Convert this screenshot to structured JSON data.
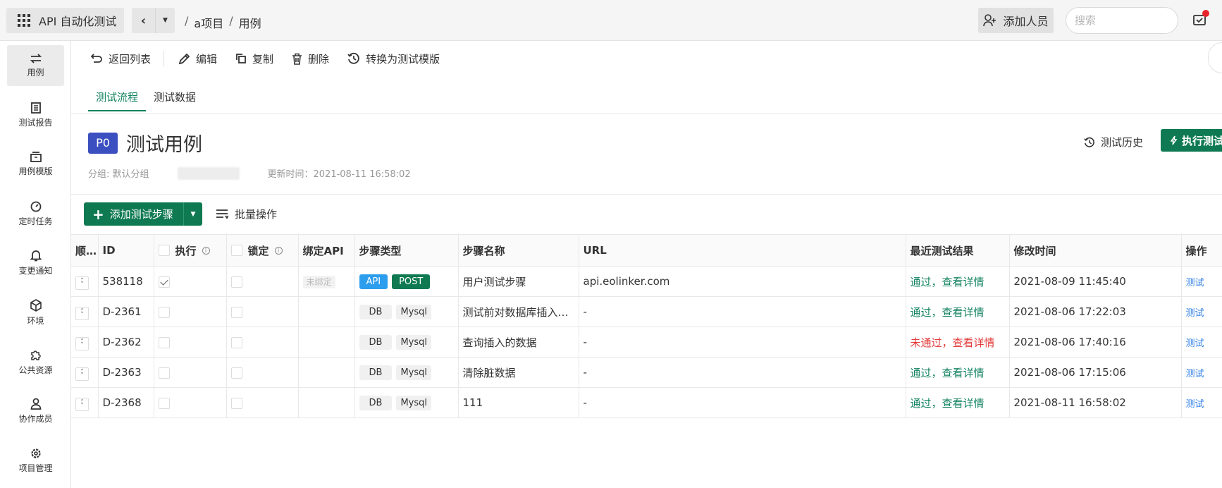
{
  "topbar": {
    "app_title": "API 自动化测试",
    "breadcrumb": [
      "a项目",
      "用例"
    ],
    "add_member": "添加人员",
    "search_placeholder": "搜索"
  },
  "sidebar": {
    "items": [
      {
        "label": "用例",
        "icon": "swap-icon",
        "active": true
      },
      {
        "label": "测试报告",
        "icon": "report-icon"
      },
      {
        "label": "用例模版",
        "icon": "template-icon"
      },
      {
        "label": "定时任务",
        "icon": "timer-icon"
      },
      {
        "label": "变更通知",
        "icon": "bell-icon"
      },
      {
        "label": "环境",
        "icon": "cube-icon"
      },
      {
        "label": "公共资源",
        "icon": "puzzle-icon"
      },
      {
        "label": "协作成员",
        "icon": "member-icon"
      },
      {
        "label": "项目管理",
        "icon": "gear-icon"
      }
    ]
  },
  "toolbar": {
    "back": "返回列表",
    "edit": "编辑",
    "copy": "复制",
    "delete": "删除",
    "convert": "转换为测试模版"
  },
  "tabs": [
    "测试流程",
    "测试数据"
  ],
  "case": {
    "priority": "P0",
    "title": "测试用例",
    "group": "分组: 默认分组",
    "updated": "更新时间：2021-08-11 16:58:02",
    "history": "测试历史",
    "execute": "执行测试"
  },
  "actions": {
    "add_step": "添加测试步骤",
    "batch": "批量操作"
  },
  "table": {
    "headers": {
      "order": "顺序",
      "id": "ID",
      "exec": "执行",
      "lock": "锁定",
      "bind_api": "绑定API",
      "step_type": "步骤类型",
      "step_name": "步骤名称",
      "url": "URL",
      "last_result": "最近测试结果",
      "modified": "修改时间",
      "ops": "操作"
    },
    "rows": [
      {
        "id": "538118",
        "exec_checked": true,
        "bind": "未绑定",
        "type1": "API",
        "type2": "POST",
        "name": "用户测试步骤",
        "url": "api.eolinker.com",
        "result": "通过，查看详情",
        "result_ok": true,
        "time": "2021-08-09 11:45:40",
        "op": "测试"
      },
      {
        "id": "D-2361",
        "exec_checked": false,
        "bind": "",
        "type1": "DB",
        "type2": "Mysql",
        "name": "测试前对数据库插入数据",
        "url": "-",
        "result": "通过，查看详情",
        "result_ok": true,
        "time": "2021-08-06 17:22:03",
        "op": "测试"
      },
      {
        "id": "D-2362",
        "exec_checked": false,
        "bind": "",
        "type1": "DB",
        "type2": "Mysql",
        "name": "查询插入的数据",
        "url": "-",
        "result": "未通过，查看详情",
        "result_ok": false,
        "time": "2021-08-06 17:40:16",
        "op": "测试"
      },
      {
        "id": "D-2363",
        "exec_checked": false,
        "bind": "",
        "type1": "DB",
        "type2": "Mysql",
        "name": "清除脏数据",
        "url": "-",
        "result": "通过，查看详情",
        "result_ok": true,
        "time": "2021-08-06 17:15:06",
        "op": "测试"
      },
      {
        "id": "D-2368",
        "exec_checked": false,
        "bind": "",
        "type1": "DB",
        "type2": "Mysql",
        "name": "111",
        "url": "-",
        "result": "通过，查看详情",
        "result_ok": true,
        "time": "2021-08-11 16:58:02",
        "op": "测试"
      }
    ]
  },
  "colors": {
    "brand": "#0f7a52",
    "api": "#2d9ded",
    "priority": "#3b4fc0",
    "fail": "#e23b3b",
    "link": "#2d7ee8"
  }
}
